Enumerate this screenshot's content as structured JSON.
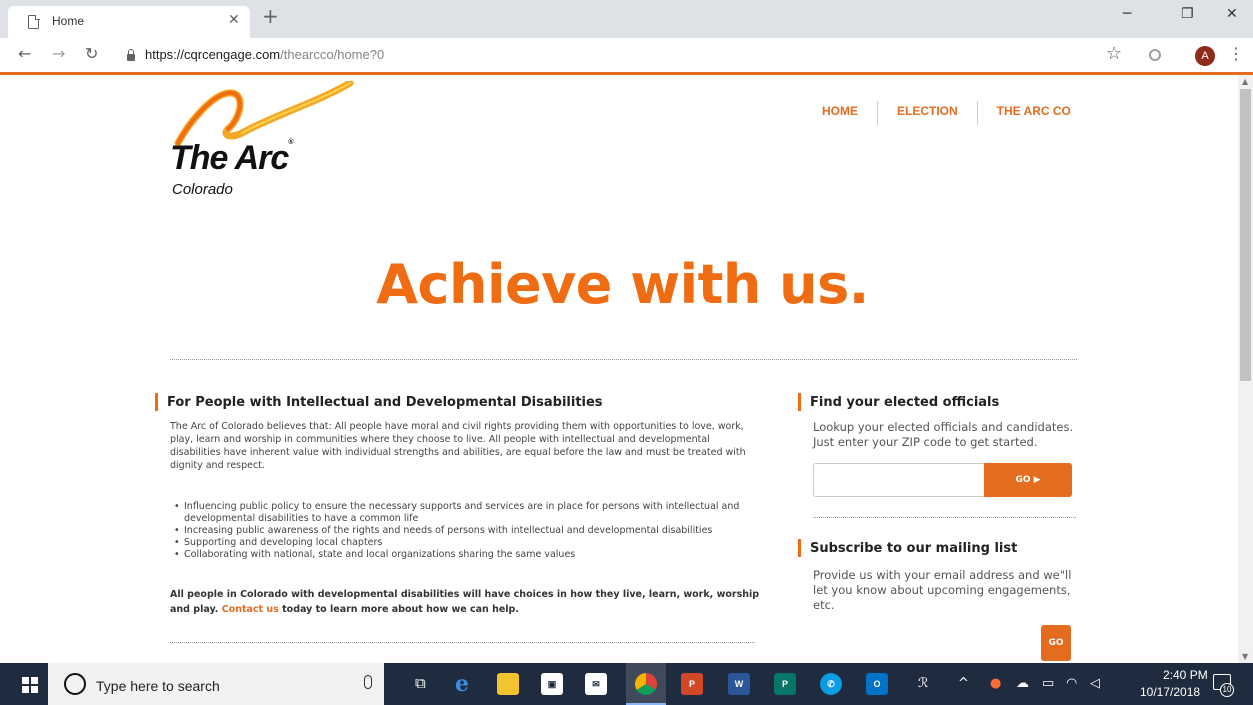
{
  "browser": {
    "tab_title": "Home",
    "url_host": "https://cqrcengage.com",
    "url_path": "/thearcco/home?0",
    "avatar_letter": "A"
  },
  "site": {
    "logo_title": "The Arc",
    "logo_subtitle": "Colorado",
    "nav": [
      "HOME",
      "ELECTION",
      "THE ARC CO"
    ],
    "hero": "Achieve with us.",
    "main": {
      "heading": "For People with Intellectual and Developmental Disabilities",
      "intro": "The Arc of Colorado believes that: All people have moral and civil rights providing them with opportunities to love, work, play, learn and worship in communities where they choose to live. All people with intellectual and developmental disabilities have inherent value with individual strengths and abilities, are equal before the law and must be treated with dignity and respect.",
      "bullets": [
        "Influencing public policy to ensure the necessary supports and services are in place for persons with intellectual and developmental disabilities to have a common life",
        "Increasing public awareness of the rights and needs of persons with intellectual and developmental disabilities",
        "Supporting and developing local chapters",
        "Collaborating with national, state and local organizations sharing the same values"
      ],
      "closing_before": "All people in Colorado with developmental disabilities will have choices in how they live, learn, work, worship and play.",
      "closing_link": "Contact us",
      "closing_after": "today to learn more about how we can help."
    },
    "officials": {
      "heading": "Find your elected officials",
      "text": "Lookup your elected officials and candidates. Just enter your ZIP code to get started.",
      "zip_value": "",
      "button": "GO ▶"
    },
    "subscribe": {
      "heading": "Subscribe to our mailing list",
      "text": "Provide us with your email address and we\"ll let you know about upcoming engagements, etc.",
      "button": "GO"
    }
  },
  "taskbar": {
    "search_placeholder": "Type here to search",
    "time": "2:40 PM",
    "date": "10/17/2018",
    "notification_count": "10"
  },
  "colors": {
    "accent": "#ef6c13",
    "taskbar": "#1f2b3e"
  }
}
